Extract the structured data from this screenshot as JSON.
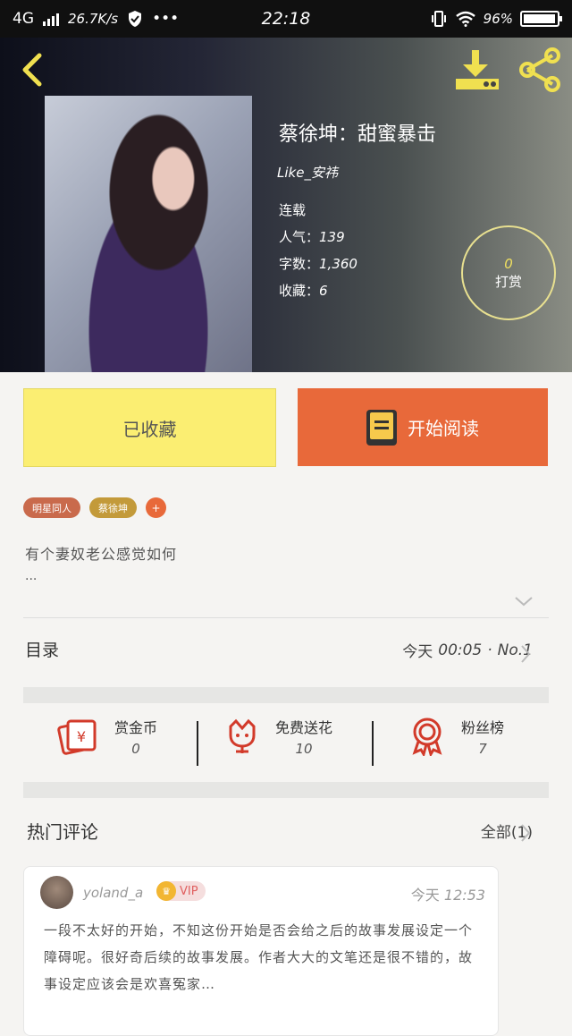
{
  "status_bar": {
    "network": "4G",
    "speed": "26.7K/s",
    "more": "•••",
    "time": "22:18",
    "battery": "96%",
    "battery_level": 0.96
  },
  "book": {
    "title": "蔡徐坤：甜蜜暴击",
    "author": "Like_安祎",
    "status": "连载",
    "popularity_label": "人气：",
    "popularity": "139",
    "words_label": "字数：",
    "words": "1,360",
    "favorites_label": "收藏：",
    "favorites": "6"
  },
  "tip": {
    "count": "0",
    "label": "打赏"
  },
  "actions": {
    "favorited_label": "已收藏",
    "read_label": "开始阅读"
  },
  "tags": [
    "明星同人",
    "蔡徐坤"
  ],
  "tag_add": "+",
  "intro": {
    "text": "有个妻奴老公感觉如何",
    "ellipsis": "..."
  },
  "toc": {
    "label": "目录",
    "latest_prefix": "今天",
    "latest_time": "00:05",
    "latest_sep": "·",
    "latest_chapter": "No.1"
  },
  "stats": [
    {
      "label": "赏金币",
      "value": "0",
      "icon": "red-envelope-icon"
    },
    {
      "label": "免费送花",
      "value": "10",
      "icon": "flower-icon"
    },
    {
      "label": "粉丝榜",
      "value": "7",
      "icon": "medal-icon"
    }
  ],
  "comments_section": {
    "title": "热门评论",
    "all_label": "全部(1)"
  },
  "comment": {
    "user": "yoland_a",
    "vip": "VIP",
    "time_prefix": "今天",
    "time": "12:53",
    "text": "一段不太好的开始，不知这份开始是否会给之后的故事发展设定一个障碍呢。很好奇后续的故事发展。作者大大的文笔还是很不错的，故事设定应该会是欢喜冤家…"
  },
  "colors": {
    "accent": "#e8693a",
    "favorite": "#fbee72",
    "tag1": "#c96a4c",
    "tag2": "#c39a3a"
  }
}
